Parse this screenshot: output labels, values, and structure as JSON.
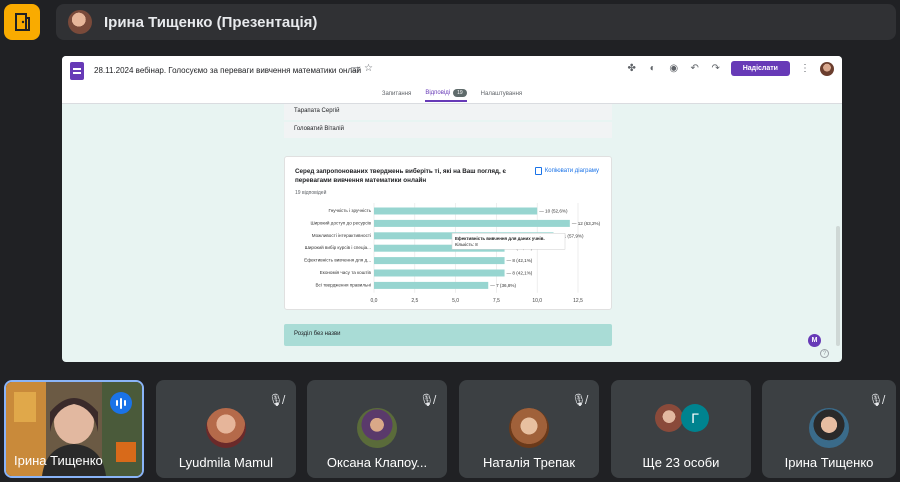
{
  "meeting": {
    "title": "Ірина Тищенко (Презентація)"
  },
  "form": {
    "doc_title": "28.11.2024 вебінар. Голосуємо за переваги вивчення математики онлай",
    "send_label": "Надіслати",
    "tabs": [
      {
        "label": "Запитання"
      },
      {
        "label": "Відповіді",
        "count": "19"
      },
      {
        "label": "Налаштування"
      }
    ],
    "respondents": [
      "Тарапата Сергій",
      "Головатий Віталій"
    ],
    "question": {
      "title": "Серед запропонованих тверджень виберіть ті, які на Ваш погляд, є перевагами вивчення математики онлайн",
      "responses": "19 відповідей",
      "copy_label": "Копіювати діаграму",
      "tooltip": {
        "line1": "Ефективність вивчення для даних учнів.",
        "line2": "Кількість: 8"
      }
    },
    "section_label": "Розділ без назви",
    "badge_letter": "M"
  },
  "chart_data": {
    "type": "bar",
    "orientation": "horizontal",
    "categories": [
      "Гнучкість і зручність",
      "Широкий доступ до ресурсів",
      "Можливості інтерактивності",
      "Широкий вибір курсів і спеціа...",
      "Ефективність вивчення для д...",
      "Економія часу та коштів",
      "Всі твердження правильні"
    ],
    "values": [
      10,
      12,
      11,
      8,
      8,
      8,
      7
    ],
    "value_labels": [
      "10 (52,6%)",
      "12 (63,2%)",
      "11 (57,9%)",
      "8 (42,1%)",
      "8 (42,1%)",
      "8 (42,1%)",
      "7 (36,8%)"
    ],
    "xlim": [
      0,
      12.5
    ],
    "xticks": [
      "0,0",
      "2,5",
      "5,0",
      "7,5",
      "10,0",
      "12,5"
    ],
    "grid": true,
    "bar_color": "#97d5d0"
  },
  "participants": [
    {
      "name": "Ірина Тищенко",
      "status": "speaking",
      "kind": "camera"
    },
    {
      "name": "Lyudmila Mamul",
      "status": "muted",
      "avatar_color": "#b56a4a"
    },
    {
      "name": "Оксана Клапоу...",
      "status": "muted",
      "avatar_color": "#5a6b3a"
    },
    {
      "name": "Наталія Трепак",
      "status": "muted",
      "avatar_color": "#a0613a"
    },
    {
      "name": "Ще 23 особи",
      "initial": "Г"
    },
    {
      "name": "Ірина Тищенко",
      "status": "muted",
      "avatar_color": "#3a6b8a"
    }
  ]
}
